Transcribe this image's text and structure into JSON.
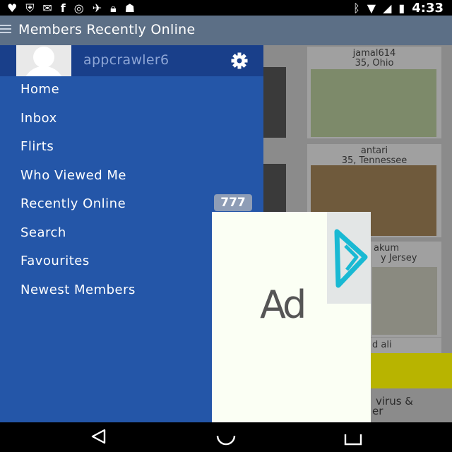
{
  "status_bar": {
    "time": "4:33",
    "icons_left": [
      "heart-icon",
      "shield-icon",
      "mail-icon",
      "facebook-icon",
      "circle-icon",
      "satellite-icon",
      "lock-icon",
      "android-icon"
    ],
    "icons_right": [
      "bluetooth-icon",
      "wifi-icon",
      "signal-icon",
      "battery-icon"
    ]
  },
  "app_bar": {
    "title": "Members Recently Online"
  },
  "drawer": {
    "username": "appcrawler6",
    "items": [
      {
        "label": "Home"
      },
      {
        "label": "Inbox"
      },
      {
        "label": "Flirts"
      },
      {
        "label": "Who Viewed Me"
      },
      {
        "label": "Recently Online",
        "badge": "777"
      },
      {
        "label": "Search"
      },
      {
        "label": "Favourites"
      },
      {
        "label": "Newest Members"
      }
    ]
  },
  "background": {
    "cards": [
      {
        "name": "jamal614",
        "info": "35, Ohio"
      },
      {
        "name": "antari",
        "info": "35, Tennessee"
      },
      {
        "name": "akum",
        "info": "y Jersey"
      },
      {
        "name": "d ali"
      }
    ],
    "promo_text": "virus &",
    "promo_text2": "er"
  },
  "ad": {
    "label": "Ad"
  }
}
